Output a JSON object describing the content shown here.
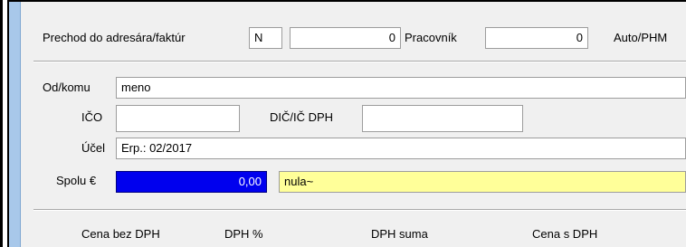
{
  "header": {
    "transfer_label": "Prechod do adresára/faktúr",
    "transfer_value": "N",
    "number_value": "0",
    "worker_label": "Pracovník",
    "worker_value": "0",
    "auto_label": "Auto/PHM"
  },
  "form": {
    "odkomu_label": "Od/komu",
    "odkomu_value": "meno",
    "ico_label": "IČO",
    "ico_value": "",
    "dic_label": "DIČ/IČ DPH",
    "dic_value": "",
    "ucel_label": "Účel",
    "ucel_value": "Erp.: 02/2017",
    "spolu_label": "Spolu €",
    "spolu_value": "0,00",
    "spolu_words": "nula~"
  },
  "columns": [
    "Cena bez DPH",
    "DPH %",
    "DPH suma",
    "Cena s DPH"
  ]
}
